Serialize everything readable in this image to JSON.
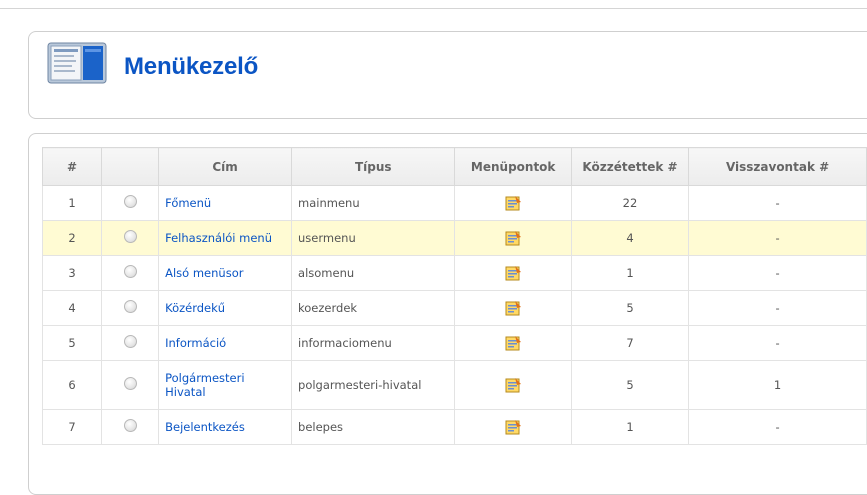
{
  "page": {
    "title": "Menükezelő"
  },
  "table": {
    "headers": [
      "#",
      "",
      "Cím",
      "Típus",
      "Menüpontok",
      "Közzétettek #",
      "Visszavontak #"
    ],
    "rows": [
      {
        "num": "1",
        "title": "Főmenü",
        "type": "mainmenu",
        "published": "22",
        "unpublished": "-"
      },
      {
        "num": "2",
        "title": "Felhasználói menü",
        "type": "usermenu",
        "published": "4",
        "unpublished": "-"
      },
      {
        "num": "3",
        "title": "Alsó menüsor",
        "type": "alsomenu",
        "published": "1",
        "unpublished": "-"
      },
      {
        "num": "4",
        "title": "Közérdekű",
        "type": "koezerdek",
        "published": "5",
        "unpublished": "-"
      },
      {
        "num": "5",
        "title": "Információ",
        "type": "informaciomenu",
        "published": "7",
        "unpublished": "-"
      },
      {
        "num": "6",
        "title": "Polgármesteri Hivatal",
        "type": "polgarmesteri-hivatal",
        "published": "5",
        "unpublished": "1"
      },
      {
        "num": "7",
        "title": "Bejelentkezés",
        "type": "belepes",
        "published": "1",
        "unpublished": "-"
      }
    ]
  }
}
